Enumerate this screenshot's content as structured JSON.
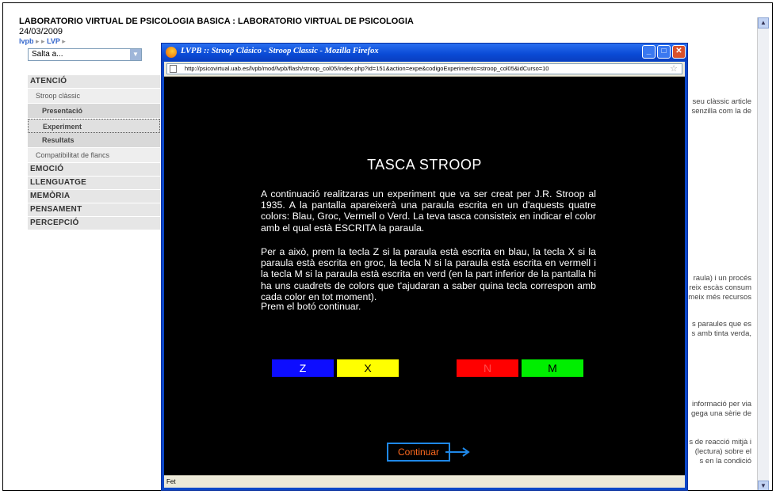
{
  "site": {
    "title": "LABORATORIO VIRTUAL DE PSICOLOGIA BASICA : LABORATORIO VIRTUAL DE PSICOLOGIA",
    "date": "24/03/2009",
    "breadcrumb": [
      "lvpb",
      "LVP"
    ],
    "jump_select": "Salta a..."
  },
  "menu": {
    "items": [
      {
        "label": "ATENCIÓ",
        "level": "cat"
      },
      {
        "label": "Stroop clàssic",
        "level": "sub"
      },
      {
        "label": "Presentació",
        "level": "sub2"
      },
      {
        "label": "Experiment",
        "level": "sub2",
        "selected": true
      },
      {
        "label": "Resultats",
        "level": "sub2"
      },
      {
        "label": "Compatibilitat de flancs",
        "level": "sub"
      },
      {
        "label": "EMOCIÓ",
        "level": "cat"
      },
      {
        "label": "LLENGUATGE",
        "level": "cat"
      },
      {
        "label": "MEMÒRIA",
        "level": "cat"
      },
      {
        "label": "PENSAMENT",
        "level": "cat"
      },
      {
        "label": "PERCEPCIÓ",
        "level": "cat"
      }
    ]
  },
  "background_text": [
    "seu clàssic article",
    "senzilla com la de",
    "raula) i un procés",
    "reix escàs consum",
    "meix més recursos",
    "s paraules que es",
    "s amb tinta verda,",
    "informació per via",
    "gega una sèrie de",
    "s de reacció mitjà i",
    "(lectura) sobre el",
    "s en la condició"
  ],
  "popup": {
    "window_title": "LVPB :: Stroop Clásico - Stroop Classic - Mozilla Firefox",
    "url": "http://psicovirtual.uab.es/lvpb/mod/lvpb/flash/stroop_col05/index.php?id=151&action=expe&codigoExperimento=stroop_col05&idCurso=10",
    "status": "Fet",
    "colors": {
      "titlebar": "#0a4bd6",
      "close": "#d9512c"
    }
  },
  "task": {
    "title": "TASCA STROOP",
    "paragraphs": [
      "A continuació realitzaras un experiment que va ser creat per J.R. Stroop al 1935. A la pantalla apareixerà una paraula escrita en un d'aquests quatre colors: Blau, Groc, Vermell o Verd. La teva tasca consisteix en indicar el color amb el qual està ESCRITA la paraula.",
      "Per a això, prem la tecla Z si la paraula està escrita en blau, la tecla X si la paraula està escrita en groc, la tecla N si la paraula està escrita en vermell i la tecla M si la paraula està escrita en verd (en la part inferior de la pantalla hi ha uns cuadrets de colors que t'ajudaran a saber quina tecla correspon amb cada color en tot moment).",
      "Prem el botó continuar."
    ],
    "keys": [
      {
        "key": "Z",
        "color": "#0d0dff",
        "text_color": "#ffffff"
      },
      {
        "key": "X",
        "color": "#ffff00",
        "text_color": "#000000"
      },
      {
        "key": "N",
        "color": "#ff0000",
        "text_color": "#ff4d4d"
      },
      {
        "key": "M",
        "color": "#00ee00",
        "text_color": "#000000"
      }
    ],
    "continue_label": "Continuar"
  }
}
